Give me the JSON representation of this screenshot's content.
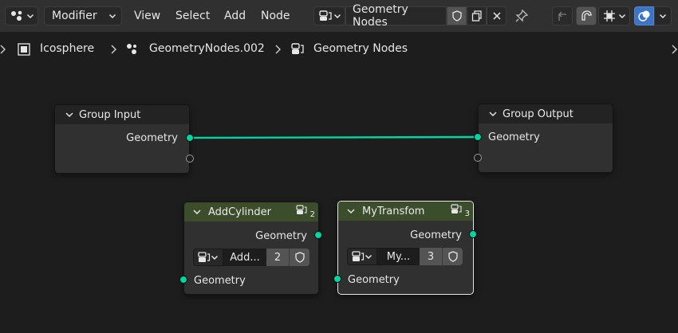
{
  "header": {
    "editor_type_icon": "node-editor-icon",
    "context_dropdown": "Modifier",
    "menus": [
      "View",
      "Select",
      "Add",
      "Node"
    ],
    "node_tree_name": "Geometry Nodes"
  },
  "breadcrumb": {
    "items": [
      "Icosphere",
      "GeometryNodes.002",
      "Geometry Nodes"
    ]
  },
  "nodes": {
    "group_input": {
      "title": "Group Input",
      "output": "Geometry"
    },
    "group_output": {
      "title": "Group Output",
      "input": "Geometry"
    },
    "add_cylinder": {
      "title": "AddCylinder",
      "group_users": "2",
      "output": "Geometry",
      "group_name": "Add...",
      "users": "2",
      "input": "Geometry"
    },
    "my_transform": {
      "title": "MyTransfom",
      "group_users": "3",
      "output": "Geometry",
      "group_name": "My...",
      "users": "3",
      "input": "Geometry"
    }
  },
  "colors": {
    "geometry_socket": "#00d6a3",
    "group_node_header": "#3b4d2b",
    "io_node_header": "#232323",
    "active_overlay": "#3d75c4"
  }
}
